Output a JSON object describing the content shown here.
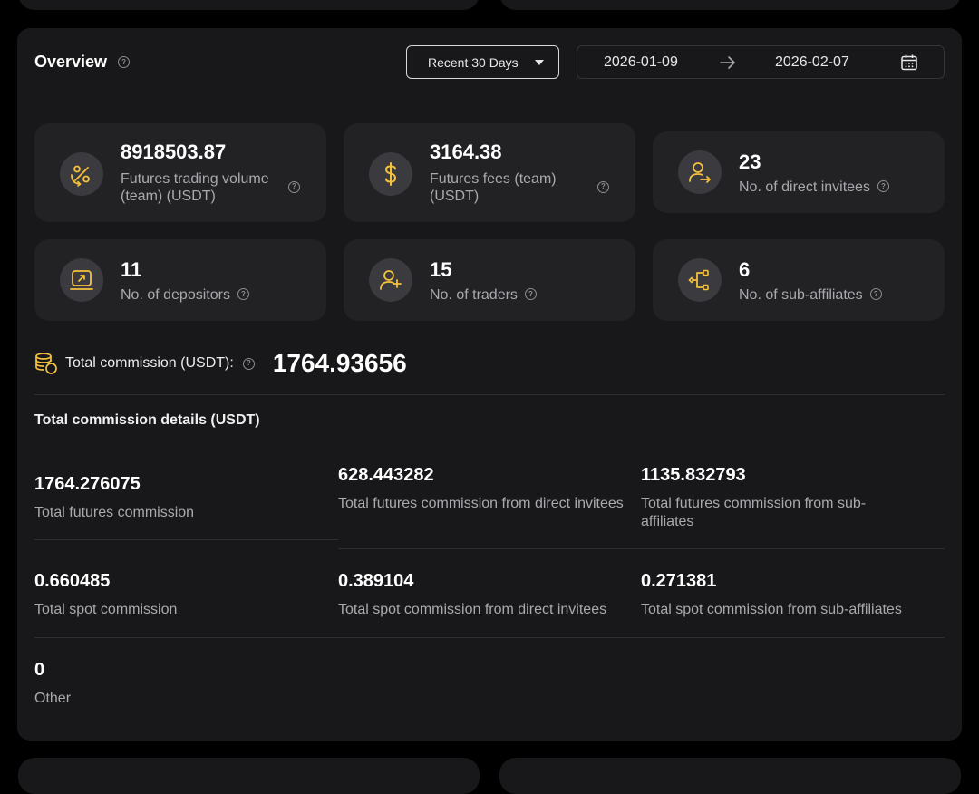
{
  "overview": {
    "title": "Overview",
    "range_label": "Recent 30 Days",
    "date_start": "2026-01-09",
    "date_end": "2026-02-07"
  },
  "stats": [
    {
      "value": "8918503.87",
      "label": "Futures trading volume (team) (USDT)",
      "icon": "percent-swap-icon"
    },
    {
      "value": "3164.38",
      "label": "Futures fees (team) (USDT)",
      "icon": "dollar-icon"
    },
    {
      "value": "23",
      "label": "No. of direct invitees",
      "icon": "user-arrow-icon"
    },
    {
      "value": "11",
      "label": "No. of depositors",
      "icon": "deposit-icon"
    },
    {
      "value": "15",
      "label": "No. of traders",
      "icon": "user-plus-icon"
    },
    {
      "value": "6",
      "label": "No. of sub-affiliates",
      "icon": "network-icon"
    }
  ],
  "total_commission": {
    "label": "Total commission (USDT):",
    "value": "1764.93656",
    "icon": "coins-icon"
  },
  "details": {
    "title": "Total commission details (USDT)",
    "items": [
      {
        "value": "1764.276075",
        "label": "Total futures commission"
      },
      {
        "value": "628.443282",
        "label": "Total futures commission from direct invitees"
      },
      {
        "value": "1135.832793",
        "label": "Total futures commission from sub-affiliates"
      },
      {
        "value": "0.660485",
        "label": "Total spot commission"
      },
      {
        "value": "0.389104",
        "label": "Total spot commission from direct invitees"
      },
      {
        "value": "0.271381",
        "label": "Total spot commission from sub-affiliates"
      },
      {
        "value": "0",
        "label": "Other"
      }
    ]
  },
  "colors": {
    "accent": "#f5c13d",
    "panel": "#18181a",
    "card": "#222225",
    "muted_text": "#a9a9ae"
  }
}
